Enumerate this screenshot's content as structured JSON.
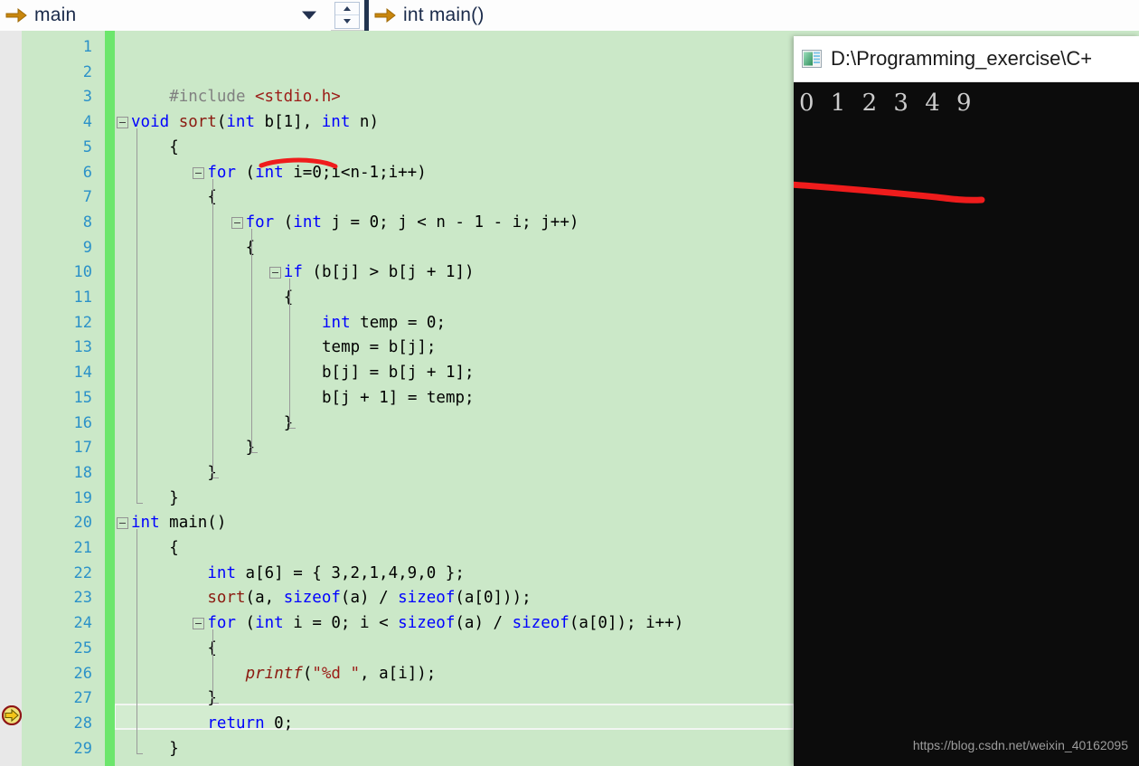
{
  "navbar": {
    "scope_icon": "arrow-right-icon",
    "scope_value": "main",
    "dropdown_icon": "chevron-down-icon",
    "spinner_up_icon": "caret-up-icon",
    "spinner_down_icon": "caret-down-icon",
    "member_icon": "arrow-right-icon",
    "member_value": "int main()"
  },
  "editor": {
    "breakpoint_icon": "breakpoint-arrow-icon",
    "current_line": 28,
    "colors": {
      "background": "#cbe8c8",
      "line_number": "#2b91c8",
      "change_bar": "#6ce66c",
      "keyword": "#0000ff",
      "function": "#8b1a10",
      "preprocessor": "#808080",
      "string": "#9b1c17",
      "plain": "#000000",
      "left_margin": "#e8e8e8"
    },
    "line_numbers": [
      1,
      2,
      3,
      4,
      5,
      6,
      7,
      8,
      9,
      10,
      11,
      12,
      13,
      14,
      15,
      16,
      17,
      18,
      19,
      20,
      21,
      22,
      23,
      24,
      25,
      26,
      27,
      28,
      29
    ],
    "lines": [
      {
        "n": 1,
        "indent": 0,
        "tokens": []
      },
      {
        "n": 2,
        "indent": 0,
        "tokens": []
      },
      {
        "n": 3,
        "indent": 1,
        "tokens": [
          {
            "t": "#include ",
            "c": "pp"
          },
          {
            "t": "<stdio.h>",
            "c": "str"
          }
        ]
      },
      {
        "n": 4,
        "indent": 0,
        "fold": true,
        "tokens": [
          {
            "t": "void ",
            "c": "kw"
          },
          {
            "t": "sort",
            "c": "fn"
          },
          {
            "t": "(",
            "c": "pl"
          },
          {
            "t": "int ",
            "c": "kw"
          },
          {
            "t": "b[1], ",
            "c": "pl"
          },
          {
            "t": "int ",
            "c": "kw"
          },
          {
            "t": "n)",
            "c": "pl"
          }
        ]
      },
      {
        "n": 5,
        "indent": 1,
        "tokens": [
          {
            "t": "{",
            "c": "pl"
          }
        ]
      },
      {
        "n": 6,
        "indent": 2,
        "fold": true,
        "tokens": [
          {
            "t": "for ",
            "c": "kw"
          },
          {
            "t": "(",
            "c": "pl"
          },
          {
            "t": "int ",
            "c": "kw"
          },
          {
            "t": "i=0;i<n-1;i++)",
            "c": "pl"
          }
        ]
      },
      {
        "n": 7,
        "indent": 2,
        "tokens": [
          {
            "t": "{",
            "c": "pl"
          }
        ]
      },
      {
        "n": 8,
        "indent": 3,
        "fold": true,
        "tokens": [
          {
            "t": "for ",
            "c": "kw"
          },
          {
            "t": "(",
            "c": "pl"
          },
          {
            "t": "int ",
            "c": "kw"
          },
          {
            "t": "j = 0; j < n - 1 - i; j++)",
            "c": "pl"
          }
        ]
      },
      {
        "n": 9,
        "indent": 3,
        "tokens": [
          {
            "t": "{",
            "c": "pl"
          }
        ]
      },
      {
        "n": 10,
        "indent": 4,
        "fold": true,
        "tokens": [
          {
            "t": "if ",
            "c": "kw"
          },
          {
            "t": "(b[j] > b[j + 1])",
            "c": "pl"
          }
        ]
      },
      {
        "n": 11,
        "indent": 4,
        "tokens": [
          {
            "t": "{",
            "c": "pl"
          }
        ]
      },
      {
        "n": 12,
        "indent": 5,
        "tokens": [
          {
            "t": "int ",
            "c": "kw"
          },
          {
            "t": "temp = 0;",
            "c": "pl"
          }
        ]
      },
      {
        "n": 13,
        "indent": 5,
        "tokens": [
          {
            "t": "temp = b[j];",
            "c": "pl"
          }
        ]
      },
      {
        "n": 14,
        "indent": 5,
        "tokens": [
          {
            "t": "b[j] = b[j + 1];",
            "c": "pl"
          }
        ]
      },
      {
        "n": 15,
        "indent": 5,
        "tokens": [
          {
            "t": "b[j + 1] = temp;",
            "c": "pl"
          }
        ]
      },
      {
        "n": 16,
        "indent": 4,
        "tokens": [
          {
            "t": "}",
            "c": "pl"
          }
        ]
      },
      {
        "n": 17,
        "indent": 3,
        "tokens": [
          {
            "t": "}",
            "c": "pl"
          }
        ]
      },
      {
        "n": 18,
        "indent": 2,
        "tokens": [
          {
            "t": "}",
            "c": "pl"
          }
        ]
      },
      {
        "n": 19,
        "indent": 1,
        "tokens": [
          {
            "t": "}",
            "c": "pl"
          }
        ]
      },
      {
        "n": 20,
        "indent": 0,
        "fold": true,
        "tokens": [
          {
            "t": "int ",
            "c": "kw"
          },
          {
            "t": "main()",
            "c": "pl"
          }
        ]
      },
      {
        "n": 21,
        "indent": 1,
        "tokens": [
          {
            "t": "{",
            "c": "pl"
          }
        ]
      },
      {
        "n": 22,
        "indent": 2,
        "tokens": [
          {
            "t": "int ",
            "c": "kw"
          },
          {
            "t": "a[6] = { 3,2,1,4,9,0 };",
            "c": "pl"
          }
        ]
      },
      {
        "n": 23,
        "indent": 2,
        "tokens": [
          {
            "t": "sort",
            "c": "fn"
          },
          {
            "t": "(a, ",
            "c": "pl"
          },
          {
            "t": "sizeof",
            "c": "kw"
          },
          {
            "t": "(a) / ",
            "c": "pl"
          },
          {
            "t": "sizeof",
            "c": "kw"
          },
          {
            "t": "(a[0]));",
            "c": "pl"
          }
        ]
      },
      {
        "n": 24,
        "indent": 2,
        "fold": true,
        "tokens": [
          {
            "t": "for ",
            "c": "kw"
          },
          {
            "t": "(",
            "c": "pl"
          },
          {
            "t": "int ",
            "c": "kw"
          },
          {
            "t": "i = 0; i < ",
            "c": "pl"
          },
          {
            "t": "sizeof",
            "c": "kw"
          },
          {
            "t": "(a) / ",
            "c": "pl"
          },
          {
            "t": "sizeof",
            "c": "kw"
          },
          {
            "t": "(a[0]); i++)",
            "c": "pl"
          }
        ]
      },
      {
        "n": 25,
        "indent": 2,
        "tokens": [
          {
            "t": "{",
            "c": "pl"
          }
        ]
      },
      {
        "n": 26,
        "indent": 3,
        "tokens": [
          {
            "t": "printf",
            "c": "mac"
          },
          {
            "t": "(",
            "c": "pl"
          },
          {
            "t": "\"%d \"",
            "c": "str"
          },
          {
            "t": ", a[i]);",
            "c": "pl"
          }
        ]
      },
      {
        "n": 27,
        "indent": 2,
        "tokens": [
          {
            "t": "}",
            "c": "pl"
          }
        ]
      },
      {
        "n": 28,
        "indent": 2,
        "tokens": [
          {
            "t": "return ",
            "c": "kw"
          },
          {
            "t": "0;",
            "c": "pl"
          }
        ]
      },
      {
        "n": 29,
        "indent": 1,
        "tokens": [
          {
            "t": "}",
            "c": "pl"
          }
        ]
      }
    ]
  },
  "annotations": {
    "underline_bracket_color": "#ef1c1c",
    "underline_output_color": "#ef1c1c"
  },
  "console": {
    "app_icon": "console-app-icon",
    "title": "D:\\Programming_exercise\\C+",
    "output": "0 1 2 3 4 9",
    "watermark": "https://blog.csdn.net/weixin_40162095",
    "background": "#0c0c0c",
    "text_color": "#cccccc"
  }
}
